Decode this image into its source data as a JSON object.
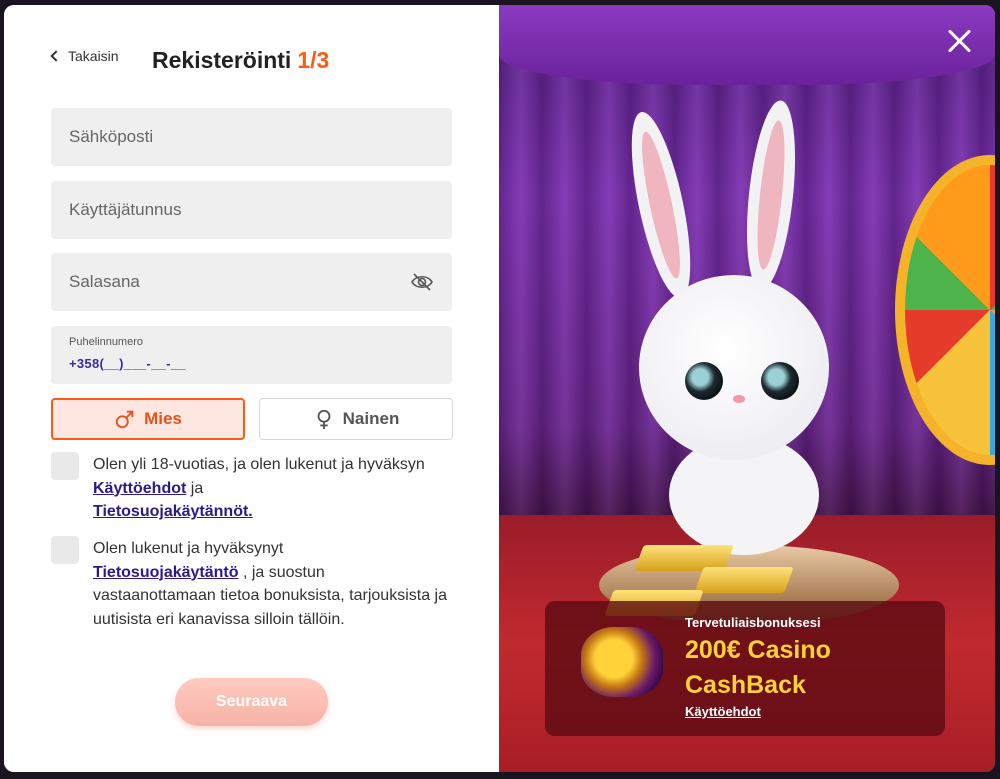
{
  "header": {
    "back_label": "Takaisin",
    "title": "Rekisteröinti",
    "step": "1/3"
  },
  "form": {
    "email_placeholder": "Sähköposti",
    "username_placeholder": "Käyttäjätunnus",
    "password_placeholder": "Salasana",
    "phone_label": "Puhelinnumero",
    "phone_value": "+358(__)___-__-__"
  },
  "gender": {
    "male": "Mies",
    "female": "Nainen",
    "selected": "Mies"
  },
  "consent1": {
    "text_a": "Olen yli 18-vuotias, ja olen lukenut ja hyväksyn ",
    "link_terms": "Käyttöehdot",
    "text_b": " ja ",
    "link_privacy": "Tietosuojakäytännöt."
  },
  "consent2": {
    "text_a": "Olen lukenut ja hyväksynyt ",
    "link_privacy": "Tietosuojakäytäntö",
    "text_b": " , ja suostun vastaanottamaan tietoa bonuksista, tarjouksista ja uutisista eri kanavissa silloin tällöin."
  },
  "next_label": "Seuraava",
  "promo": {
    "subtitle": "Tervetuliaisbonuksesi",
    "headline": "200€ Casino CashBack",
    "terms_link": "Käyttöehdot"
  },
  "colors": {
    "accent": "#ff5a14",
    "link": "#2a1a8c",
    "promo_gold": "#ffd23a"
  }
}
